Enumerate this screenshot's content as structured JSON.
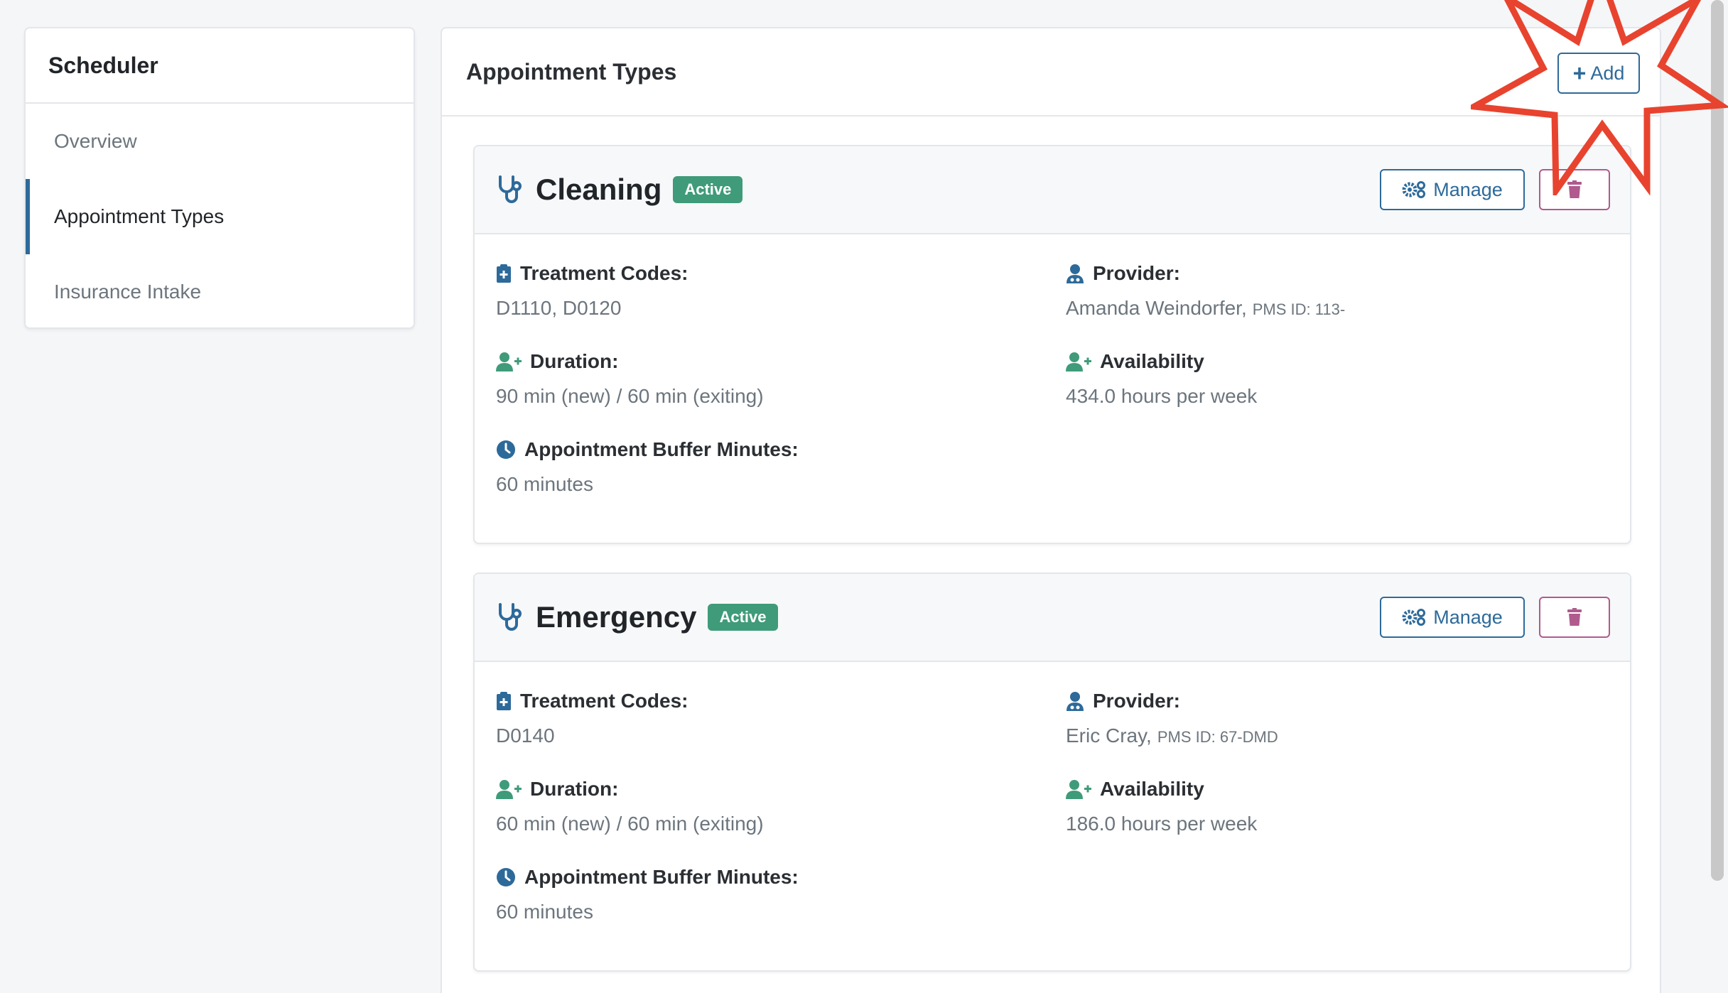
{
  "sidebar": {
    "title": "Scheduler",
    "items": [
      {
        "label": "Overview",
        "active": false
      },
      {
        "label": "Appointment Types",
        "active": true
      },
      {
        "label": "Insurance Intake",
        "active": false
      }
    ]
  },
  "main": {
    "title": "Appointment Types",
    "add_label": "Add"
  },
  "cards": [
    {
      "name": "Cleaning",
      "status": "Active",
      "manage_label": "Manage",
      "treatment_codes_label": "Treatment Codes:",
      "treatment_codes": "D1110, D0120",
      "provider_label": "Provider:",
      "provider_name": "Amanda Weindorfer,",
      "provider_pms": "PMS ID: 113-",
      "duration_label": "Duration:",
      "duration": "90 min (new) / 60 min (exiting)",
      "availability_label": "Availability",
      "availability": "434.0 hours per week",
      "buffer_label": "Appointment Buffer Minutes:",
      "buffer": "60 minutes"
    },
    {
      "name": "Emergency",
      "status": "Active",
      "manage_label": "Manage",
      "treatment_codes_label": "Treatment Codes:",
      "treatment_codes": "D0140",
      "provider_label": "Provider:",
      "provider_name": "Eric Cray,",
      "provider_pms": "PMS ID: 67-DMD",
      "duration_label": "Duration:",
      "duration": "60 min (new) / 60 min (exiting)",
      "availability_label": "Availability",
      "availability": "186.0 hours per week",
      "buffer_label": "Appointment Buffer Minutes:",
      "buffer": "60 minutes"
    }
  ],
  "colors": {
    "primary": "#2d6a9a",
    "success": "#3f9b79",
    "danger": "#b05a8e",
    "highlight": "#e8432e"
  },
  "icons": {
    "card": "stethoscope-icon",
    "treatment": "clipboard-medical-icon",
    "provider": "user-doctor-icon",
    "duration": "user-plus-icon",
    "availability": "user-plus-icon",
    "buffer": "clock-icon",
    "manage": "gears-icon",
    "delete": "trash-icon",
    "add": "plus-icon"
  }
}
